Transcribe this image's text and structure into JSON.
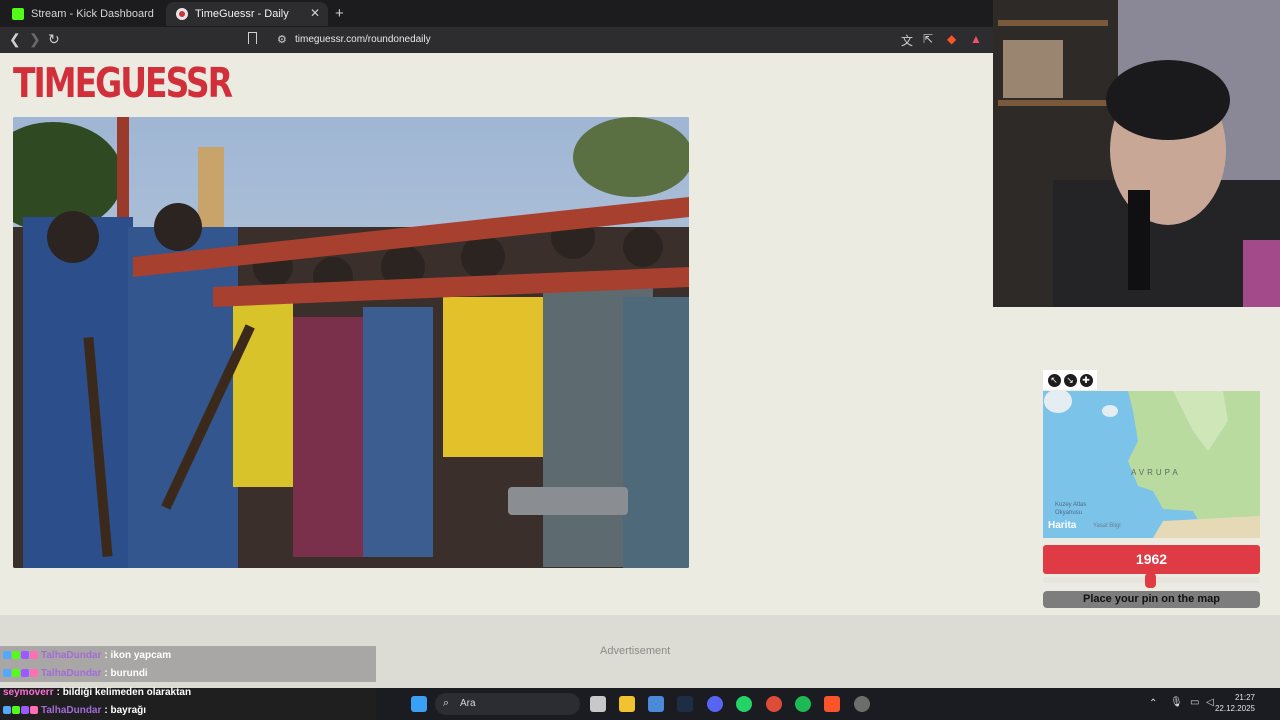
{
  "browser": {
    "tabs": [
      {
        "title": "Stream - Kick Dashboard",
        "active": false
      },
      {
        "title": "TimeGuessr - Daily",
        "active": true
      }
    ],
    "url": "timeguessr.com/roundonedaily"
  },
  "page": {
    "logo": "TIMEGUESSR",
    "map": {
      "region_label": "AVRUPA",
      "ocean_label": "Kuzey Atlas Okyanusu",
      "brand": "Harita",
      "legal": "Yasal Bilgi"
    },
    "year": "1962",
    "place_pin": "Place your pin on the map",
    "advertisement": "Advertisement"
  },
  "chat": {
    "messages": [
      {
        "user": "TalhaDundar",
        "text": "ikon yapcam"
      },
      {
        "user": "TalhaDundar",
        "text": "burundi"
      },
      {
        "user": "seymoverr",
        "text": "bildiği kelimeden olaraktan"
      },
      {
        "user": "TalhaDundar",
        "text": "bayrağı"
      }
    ]
  },
  "taskbar": {
    "search_placeholder": "Ara",
    "time": "21:27",
    "date": "22.12.2025"
  },
  "colors": {
    "brand_red": "#de3b45",
    "page_bg": "#ecebe2"
  }
}
